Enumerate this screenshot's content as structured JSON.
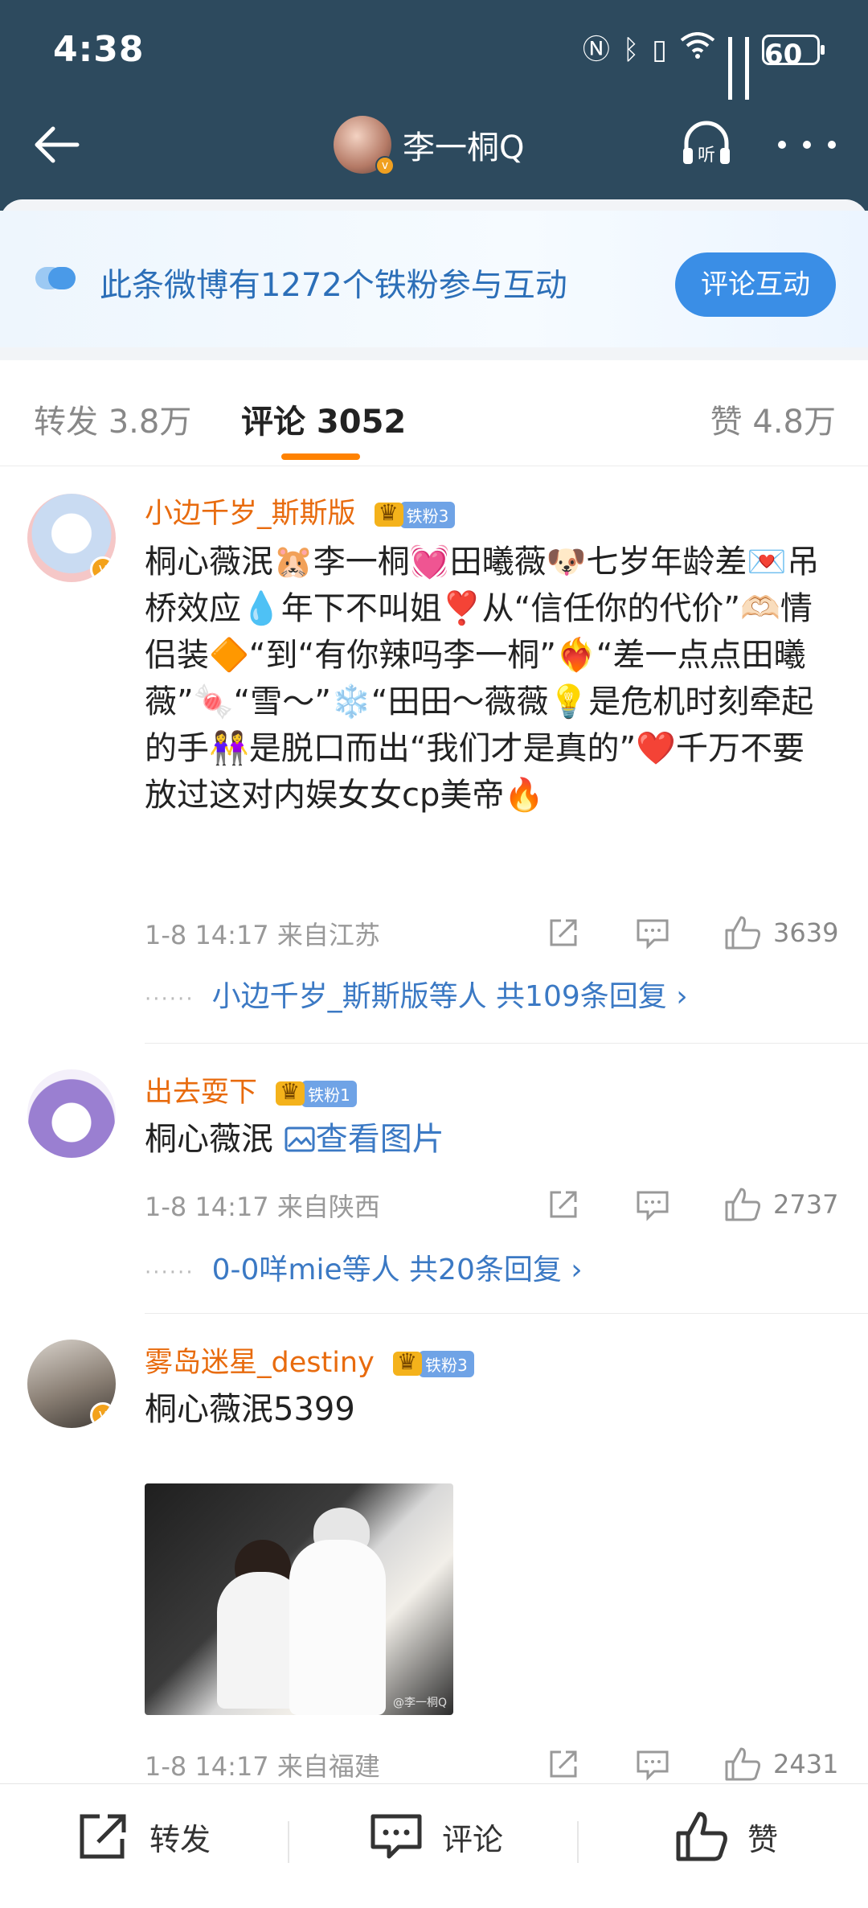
{
  "status_bar": {
    "time": "4:38",
    "battery": "60"
  },
  "nav": {
    "user_name": "李一桐Q",
    "listen_label": "听"
  },
  "banner": {
    "text": "此条微博有1272个铁粉参与互动",
    "button": "评论互动"
  },
  "tabs": {
    "repost": "转发 3.8万",
    "comment": "评论 3052",
    "like": "赞 4.8万"
  },
  "comments": [
    {
      "user": "小边千岁_斯斯版",
      "fan_level": "铁粉3",
      "text": "桐心薇泯🐹李一桐💓田曦薇🐶七岁年龄差💌吊桥效应💧年下不叫姐❣️从“信任你的代价”🫶🏻情侣装🔶“到“有你辣吗李一桐”❤️‍🔥“差一点点田曦薇”🍬“雪～”❄️“田田～薇薇💡是危机时刻牵起的手👭是脱口而出“我们才是真的”❤️千万不要放过这对内娱女女cp美帝🔥",
      "time_location": "1-8 14:17  来自江苏",
      "likes": "3639",
      "replies": "小边千岁_斯斯版等人  共109条回复 ›"
    },
    {
      "user": "出去耍下",
      "fan_level": "铁粉1",
      "text": "桐心薇泯",
      "image_link": "查看图片",
      "time_location": "1-8 14:17  来自陕西",
      "likes": "2737",
      "replies": "0-0咩mie等人  共20条回复 ›"
    },
    {
      "user": "雾岛迷星_destiny",
      "fan_level": "铁粉3",
      "text": "桐心薇泯5399",
      "photo_watermark": "@李一桐Q",
      "time_location": "1-8 14:17  来自福建",
      "likes": "2431"
    }
  ],
  "bottom_bar": {
    "repost": "转发",
    "comment": "评论",
    "like": "赞"
  },
  "colors": {
    "header_bg": "#2d4a5e",
    "accent_orange": "#ff8200",
    "username_orange": "#e86b0e",
    "link_blue": "#3b79c4",
    "banner_button": "#3a8ee6"
  },
  "icons": [
    "back-arrow-icon",
    "headphone-listen-icon",
    "more-dots-icon",
    "share-icon",
    "comment-icon",
    "like-thumb-icon",
    "image-icon",
    "wifi-icon",
    "bluetooth-icon",
    "nfc-icon",
    "vibrate-icon"
  ]
}
